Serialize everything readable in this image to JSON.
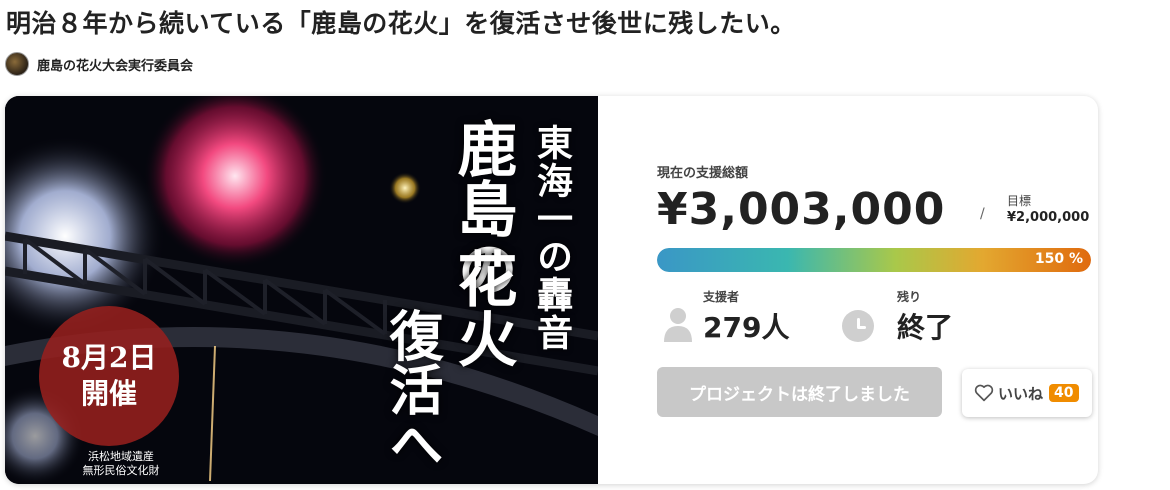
{
  "project": {
    "title": "明治８年から続いている「鹿島の花火」を復活させ後世に残したい。",
    "owner": "鹿島の花火大会実行委員会"
  },
  "hero": {
    "subtitle": "東海一の轟音",
    "main_title_1": "鹿島の",
    "main_title_2": "花火",
    "main_title_3": "復活へ",
    "date": "8月2日",
    "event": "開催",
    "heritage_1": "浜松地域遺産",
    "heritage_2": "無形民俗文化財"
  },
  "funding": {
    "total_label": "現在の支援総額",
    "total_amount": "¥3,003,000",
    "separator": "/",
    "goal_label": "目標",
    "goal_amount": "¥2,000,000",
    "progress_text": "150 %",
    "progress_fraction": 1.5,
    "backers_label": "支援者",
    "backers": "279人",
    "remaining_label": "残り",
    "remaining": "終了"
  },
  "actions": {
    "ended_button": "プロジェクトは終了しました",
    "like_label": "いいね",
    "like_count": "40"
  },
  "icons": {
    "avatar": "owner-avatar",
    "backers": "person-icon",
    "remaining": "clock-icon",
    "like": "heart-icon"
  },
  "colors": {
    "progress_start": "#3a97c6",
    "progress_end": "#e06a0e",
    "like_badge": "#f08c00",
    "date_badge": "#96201e"
  }
}
